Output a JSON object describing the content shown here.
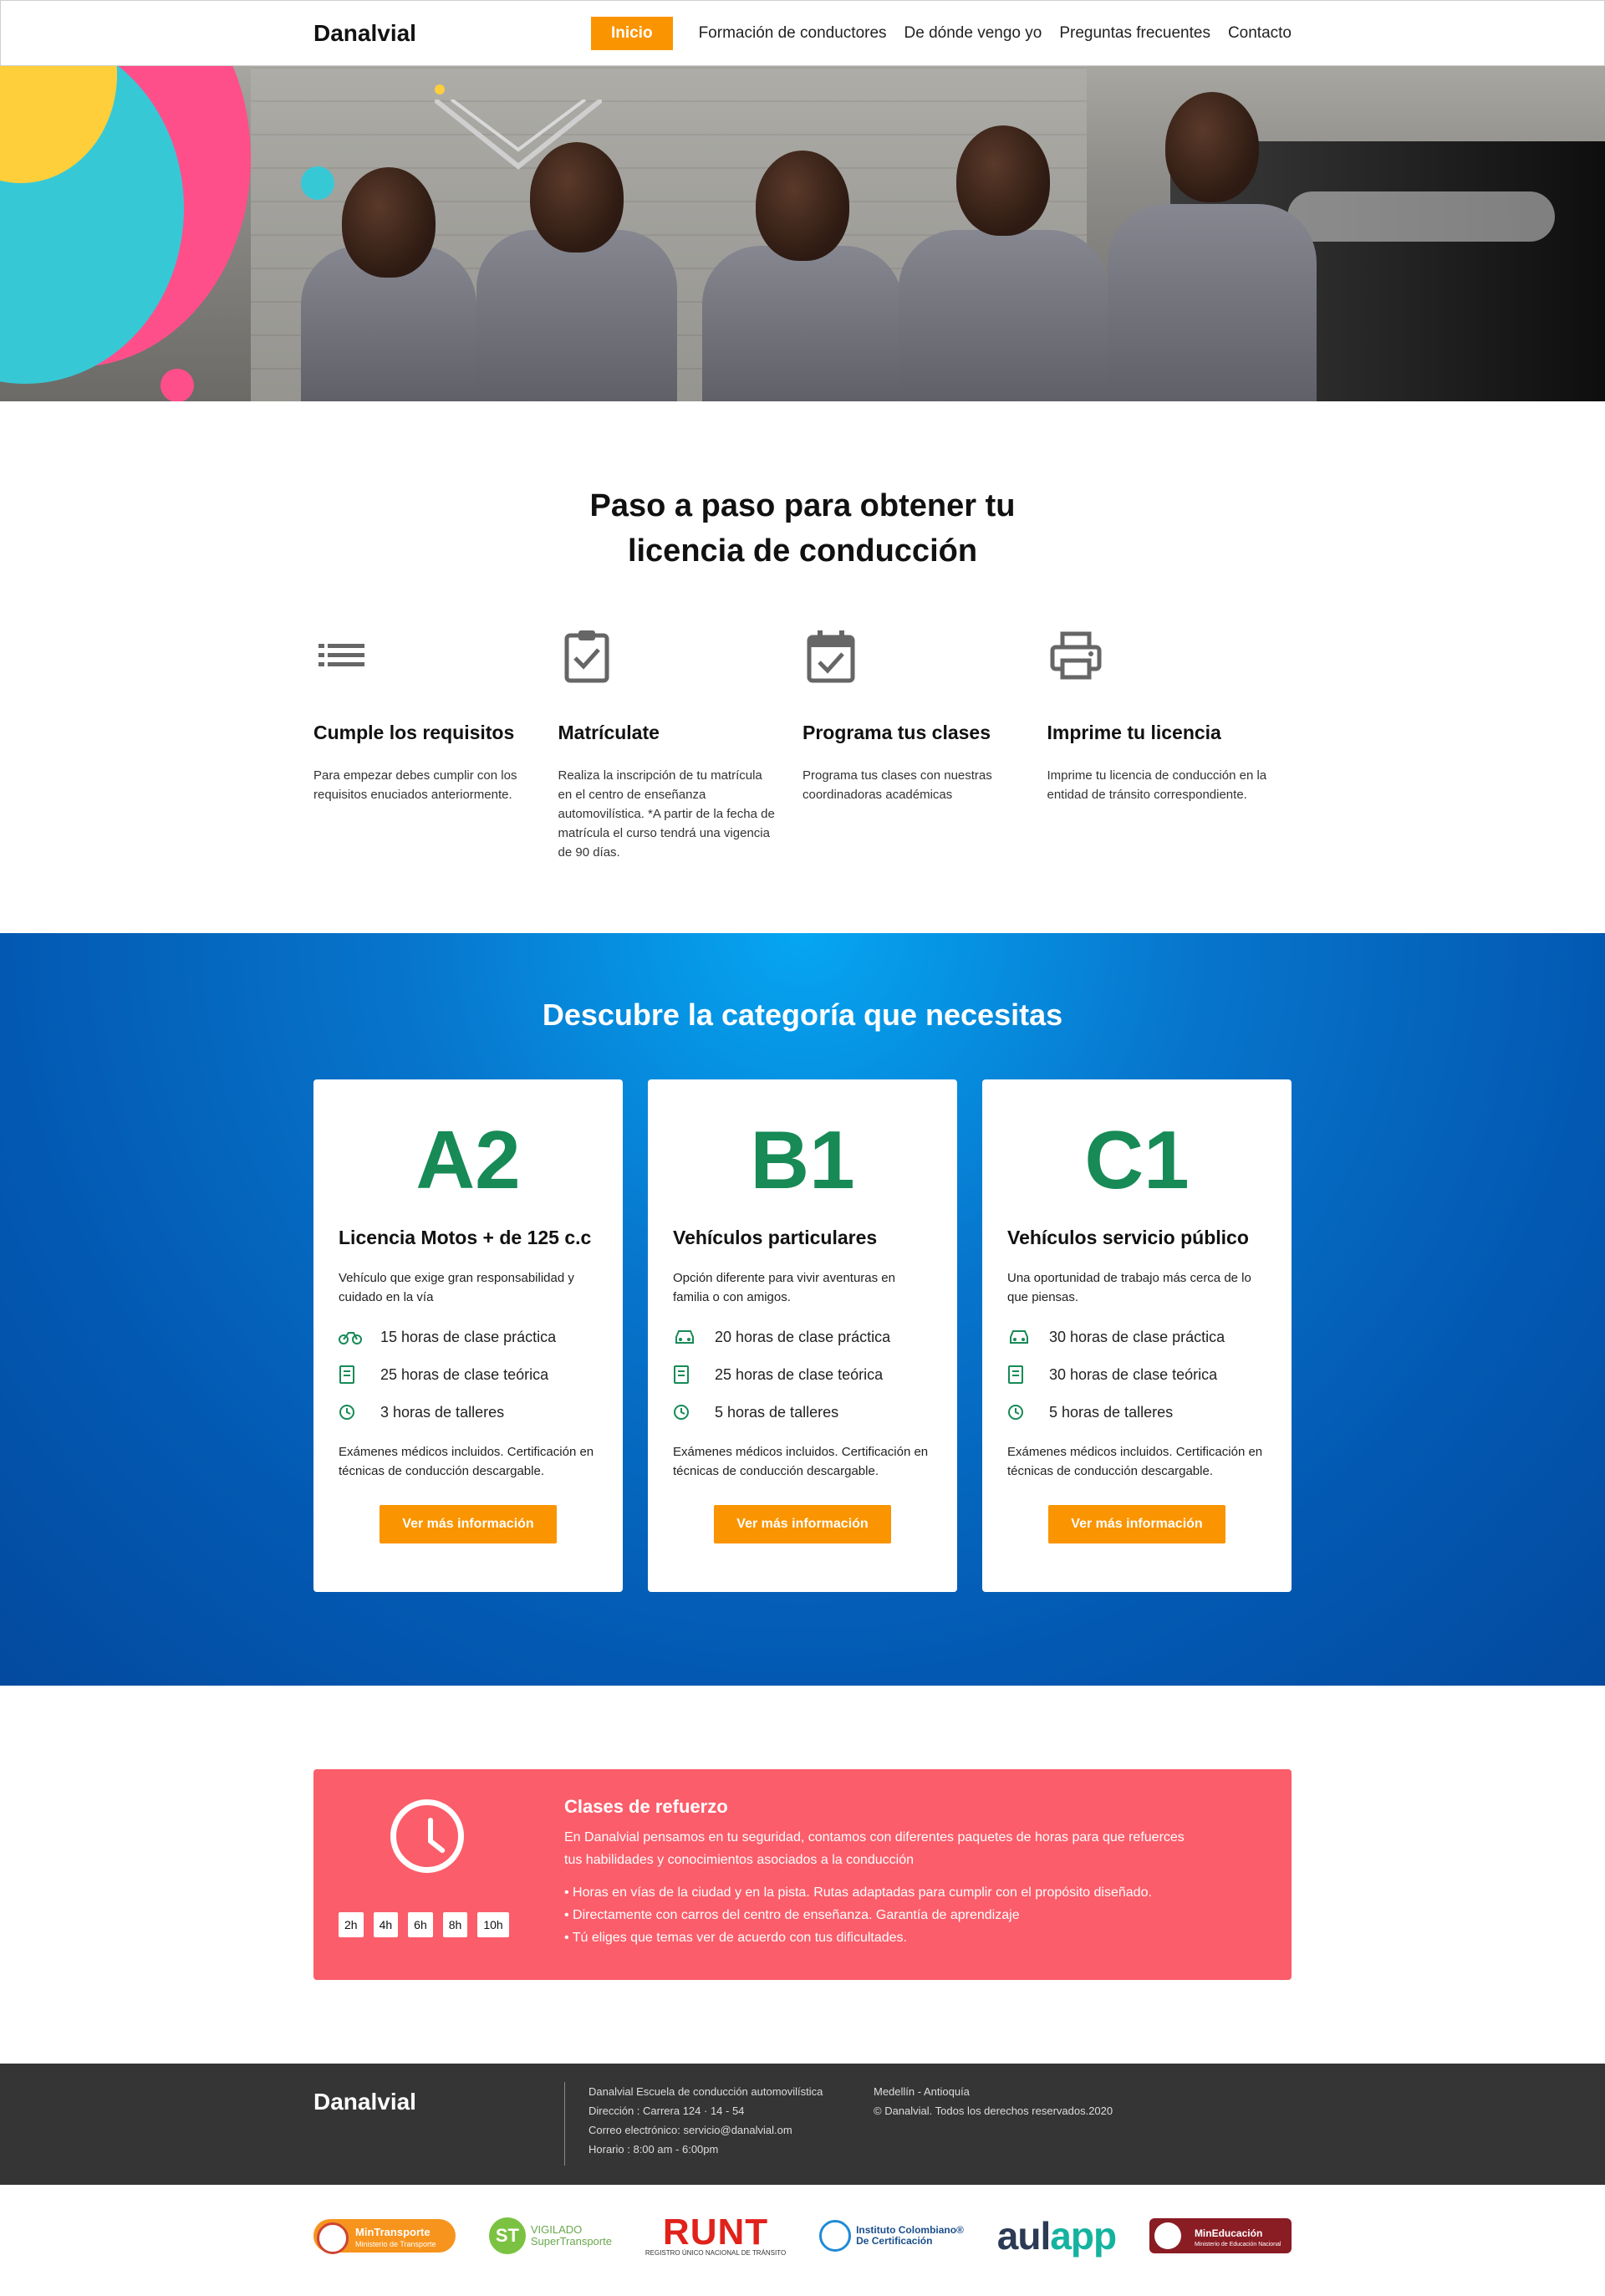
{
  "nav": {
    "brand": "Danalvial",
    "items": [
      {
        "label": "Inicio",
        "active": true
      },
      {
        "label": "Formación de conductores"
      },
      {
        "label": "De dónde vengo yo"
      },
      {
        "label": "Preguntas frecuentes"
      },
      {
        "label": "Contacto"
      }
    ]
  },
  "steps": {
    "title": "Paso a paso para obtener tu licencia de conducción",
    "items": [
      {
        "icon": "list-icon",
        "title": "Cumple los requisitos",
        "text": "Para empezar debes cumplir con los requisitos enuciados anteriormente."
      },
      {
        "icon": "clipboard-check-icon",
        "title": "Matrículate",
        "text": "Realiza la inscripción de tu matrícula en el centro de enseñanza automovilística. *A partir de la fecha de matrícula el curso tendrá una vigencia de 90 días."
      },
      {
        "icon": "calendar-check-icon",
        "title": "Programa tus clases",
        "text": "Programa tus clases con nuestras coordinadoras académicas"
      },
      {
        "icon": "printer-icon",
        "title": "Imprime tu licencia",
        "text": "Imprime tu licencia de conducción en la entidad de tránsito correspondiente."
      }
    ]
  },
  "categories": {
    "title": "Descubre la categoría que necesitas",
    "accent": "#178a56",
    "button_color": "#fa9400",
    "cards": [
      {
        "code": "A2",
        "title": "Licencia Motos + de 125 c.c",
        "desc": "Vehículo que exige gran responsabilidad y cuidado en la vía",
        "features": [
          {
            "icon": "motorcycle-icon",
            "text": "15 horas de clase práctica"
          },
          {
            "icon": "book-icon",
            "text": "25 horas de clase teórica"
          },
          {
            "icon": "clock-icon",
            "text": "3 horas de talleres"
          }
        ],
        "note": "Exámenes médicos incluidos. Certificación en técnicas de conducción descargable.",
        "button": "Ver más información"
      },
      {
        "code": "B1",
        "title": "Vehículos particulares",
        "desc": "Opción diferente para vivir aventuras en familia o con amigos.",
        "features": [
          {
            "icon": "car-icon",
            "text": "20 horas de clase práctica"
          },
          {
            "icon": "book-icon",
            "text": "25 horas de clase teórica"
          },
          {
            "icon": "clock-icon",
            "text": "5 horas de talleres"
          }
        ],
        "note": "Exámenes médicos incluidos. Certificación en técnicas de conducción descargable.",
        "button": "Ver más información"
      },
      {
        "code": "C1",
        "title": "Vehículos servicio público",
        "desc": "Una oportunidad de trabajo más cerca de lo que piensas.",
        "features": [
          {
            "icon": "car-icon",
            "text": "30 horas de clase práctica"
          },
          {
            "icon": "book-icon",
            "text": "30 horas de clase teórica"
          },
          {
            "icon": "clock-icon",
            "text": "5 horas de talleres"
          }
        ],
        "note": "Exámenes médicos incluidos. Certificación en técnicas de conducción descargable.",
        "button": "Ver más información"
      }
    ]
  },
  "refuerzo": {
    "title": "Clases de refuerzo",
    "color": "#fb5d6a",
    "intro": "En Danalvial pensamos en tu seguridad, contamos con diferentes paquetes de horas para que refuerces tus habilidades y conocimientos asociados a la conducción",
    "hours": [
      "2h",
      "4h",
      "6h",
      "8h",
      "10h"
    ],
    "bullets": [
      "Horas en vías de la ciudad y en la pista. Rutas adaptadas para cumplir con el propósito diseñado.",
      "Directamente con carros del centro de enseñanza. Garantía de aprendizaje",
      "Tú eliges que temas ver de acuerdo con tus dificultades."
    ]
  },
  "footer": {
    "brand": "Danalvial",
    "col1": [
      "Danalvial  Escuela de conducción automovilística",
      "Dirección : Carrera 124 · 14 - 54",
      "Correo electrónico: servicio@danalvial.om",
      "Horario : 8:00 am - 6:00pm"
    ],
    "col2": [
      "Medellín - Antioquía",
      "© Danalvial. Todos los derechos reservados.2020"
    ]
  },
  "logos": {
    "mintransporte": {
      "title": "MinTransporte",
      "sub": "Ministerio de Transporte"
    },
    "supertransporte": {
      "badge": "ST",
      "line1": "VIGILADO",
      "line2": "SuperTransporte"
    },
    "runt": {
      "title": "RUNT",
      "sub": "REGISTRO ÚNICO NACIONAL DE TRÁNSITO"
    },
    "icc": {
      "line1": "Instituto Colombiano®",
      "line2": "De Certificación"
    },
    "aulapp": {
      "a": "aul",
      "b": "app"
    },
    "mineducacion": {
      "title": "MinEducación",
      "sub": "Ministerio de Educación Nacional"
    }
  }
}
